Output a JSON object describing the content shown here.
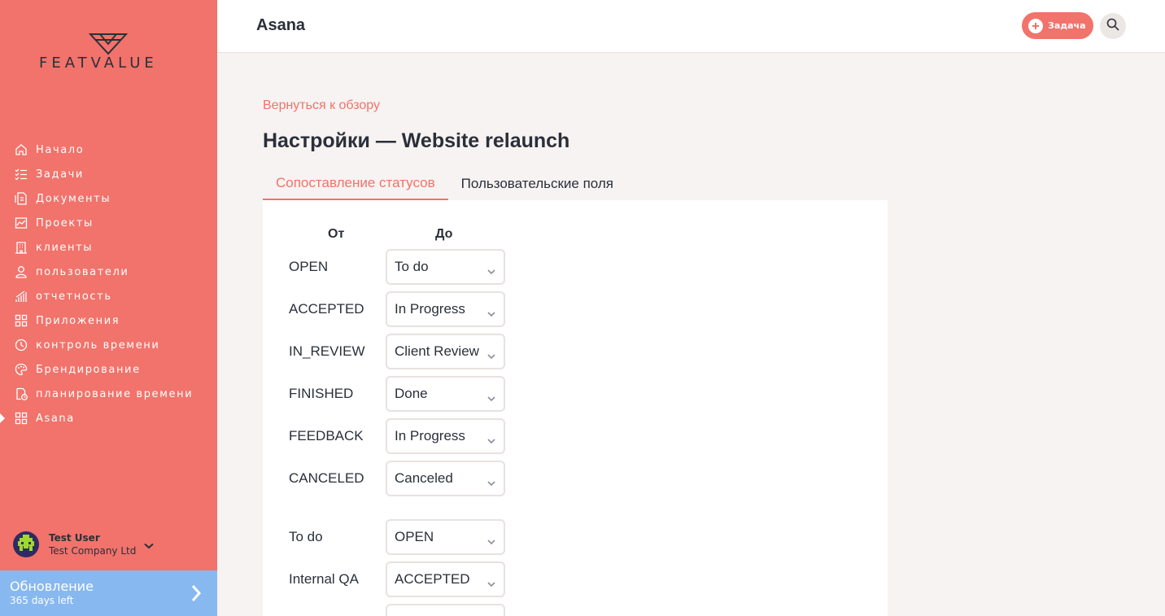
{
  "sidebar": {
    "logo_text": "FEATVALUE",
    "items": [
      {
        "label": "Начало",
        "icon": "home-icon"
      },
      {
        "label": "Задачи",
        "icon": "tasks-icon"
      },
      {
        "label": "Документы",
        "icon": "documents-icon"
      },
      {
        "label": "Проекты",
        "icon": "projects-icon"
      },
      {
        "label": "клиенты",
        "icon": "clients-icon"
      },
      {
        "label": "пользователи",
        "icon": "user-icon"
      },
      {
        "label": "отчетность",
        "icon": "reporting-icon"
      },
      {
        "label": "Приложения",
        "icon": "apps-icon"
      },
      {
        "label": "контроль времени",
        "icon": "time-control-icon"
      },
      {
        "label": "Брендирование",
        "icon": "branding-icon"
      },
      {
        "label": "планирование времени",
        "icon": "time-planning-icon"
      },
      {
        "label": "Asana",
        "icon": "apps-icon",
        "active": true
      }
    ],
    "user": {
      "name": "Test User",
      "company": "Test Company Ltd"
    },
    "upgrade": {
      "title": "Обновление",
      "subtitle": "365 days left"
    }
  },
  "header": {
    "title": "Asana",
    "task_button": "Задача"
  },
  "main": {
    "back_link": "Вернуться к обзору",
    "page_title": "Настройки — Website relaunch",
    "tabs": [
      {
        "label": "Сопоставление статусов",
        "active": true
      },
      {
        "label": "Пользовательские поля",
        "active": false
      }
    ],
    "columns": {
      "from": "От",
      "to": "До"
    },
    "mappings_out": [
      {
        "from": "OPEN",
        "to": "To do"
      },
      {
        "from": "ACCEPTED",
        "to": "In Progress"
      },
      {
        "from": "IN_REVIEW",
        "to": "Client Review"
      },
      {
        "from": "FINISHED",
        "to": "Done"
      },
      {
        "from": "FEEDBACK",
        "to": "In Progress"
      },
      {
        "from": "CANCELED",
        "to": "Canceled"
      }
    ],
    "mappings_in": [
      {
        "from": "To do",
        "to": "OPEN"
      },
      {
        "from": "Internal QA",
        "to": "ACCEPTED"
      }
    ]
  },
  "colors": {
    "accent": "#f1736b",
    "upgrade": "#88b8f0",
    "text": "#2b2f3a"
  }
}
